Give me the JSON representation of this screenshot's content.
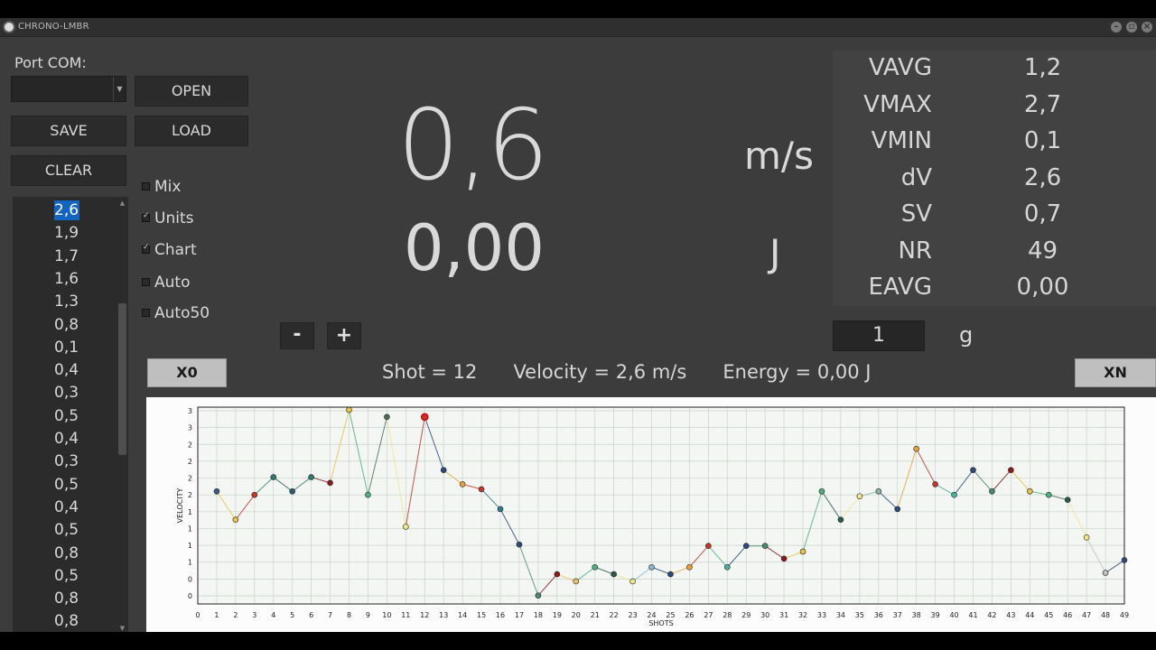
{
  "window": {
    "title": "CHRONO-LMBR"
  },
  "titlebar_buttons": {
    "minimize": "–",
    "restore": "▫",
    "close": "×"
  },
  "port": {
    "label": "Port COM:",
    "selected": ""
  },
  "buttons": {
    "open": "OPEN",
    "save": "SAVE",
    "load": "LOAD",
    "clear": "CLEAR",
    "minus": "-",
    "plus": "+",
    "x0": "X0",
    "xn": "XN"
  },
  "shot_list": [
    "2,6",
    "1,9",
    "1,7",
    "1,6",
    "1,3",
    "0,8",
    "0,1",
    "0,4",
    "0,3",
    "0,5",
    "0,4",
    "0,3",
    "0,5",
    "0,4",
    "0,5",
    "0,8",
    "0,5",
    "0,8",
    "0,8"
  ],
  "shot_list_selected_index": 0,
  "options": [
    {
      "label": "Mix",
      "checked": false
    },
    {
      "label": "Units",
      "checked": true
    },
    {
      "label": "Chart",
      "checked": true
    },
    {
      "label": "Auto",
      "checked": false
    },
    {
      "label": "Auto50",
      "checked": false
    }
  ],
  "display": {
    "velocity": "0,6",
    "velocity_unit": "m/s",
    "energy": "0,00",
    "energy_unit": "J"
  },
  "stats": [
    {
      "name": "VAVG",
      "value": "1,2"
    },
    {
      "name": "VMAX",
      "value": "2,7"
    },
    {
      "name": "VMIN",
      "value": "0,1"
    },
    {
      "name": "dV",
      "value": "2,6"
    },
    {
      "name": "SV",
      "value": "0,7"
    },
    {
      "name": "NR",
      "value": "49"
    },
    {
      "name": "EAVG",
      "value": "0,00"
    }
  ],
  "mass": {
    "value": "1",
    "unit": "g"
  },
  "shot_info": "Shot = 12      Velocity = 2,6 m/s      Energy = 0,00 J",
  "chart_data": {
    "type": "line",
    "xlabel": "SHOTS",
    "ylabel": "VELOCITY",
    "x_ticks": [
      "0",
      "1",
      "2",
      "3",
      "4",
      "5",
      "6",
      "7",
      "8",
      "9",
      "10",
      "11",
      "12",
      "13",
      "14",
      "15",
      "16",
      "17",
      "18",
      "19",
      "20",
      "21",
      "22",
      "23",
      "24",
      "25",
      "26",
      "27",
      "28",
      "29",
      "30",
      "31",
      "32",
      "33",
      "34",
      "35",
      "36",
      "37",
      "38",
      "39",
      "40",
      "41",
      "42",
      "43",
      "44",
      "45",
      "46",
      "47",
      "48",
      "49"
    ],
    "y_ticks": [
      "0",
      "0",
      "1",
      "1",
      "1",
      "1",
      "2",
      "2",
      "2",
      "2",
      "3",
      "3"
    ],
    "xlim": [
      0,
      49
    ],
    "ylim": [
      0,
      2.65
    ],
    "grid": true,
    "points": [
      {
        "x": 1,
        "y": 1.5,
        "color": "#3d5a8a"
      },
      {
        "x": 2,
        "y": 1.1,
        "color": "#e8c24a"
      },
      {
        "x": 3,
        "y": 1.45,
        "color": "#c0392b"
      },
      {
        "x": 4,
        "y": 1.7,
        "color": "#2e7d6e"
      },
      {
        "x": 5,
        "y": 1.5,
        "color": "#2e5a6e"
      },
      {
        "x": 6,
        "y": 1.7,
        "color": "#2e7d6e"
      },
      {
        "x": 7,
        "y": 1.62,
        "color": "#8b1a1a"
      },
      {
        "x": 8,
        "y": 2.65,
        "color": "#e8c24a"
      },
      {
        "x": 9,
        "y": 1.45,
        "color": "#4caf7d"
      },
      {
        "x": 10,
        "y": 2.55,
        "color": "#4a6e5a"
      },
      {
        "x": 11,
        "y": 1.0,
        "color": "#f0e68c"
      },
      {
        "x": 12,
        "y": 2.55,
        "color": "#c0392b"
      },
      {
        "x": 13,
        "y": 1.8,
        "color": "#2e4a7a"
      },
      {
        "x": 14,
        "y": 1.6,
        "color": "#e8a23a"
      },
      {
        "x": 15,
        "y": 1.53,
        "color": "#c0392b"
      },
      {
        "x": 16,
        "y": 1.25,
        "color": "#2e7d8e"
      },
      {
        "x": 17,
        "y": 0.75,
        "color": "#2e4a7a"
      },
      {
        "x": 18,
        "y": 0.03,
        "color": "#4a8a6e"
      },
      {
        "x": 19,
        "y": 0.33,
        "color": "#8b1a1a"
      },
      {
        "x": 20,
        "y": 0.23,
        "color": "#f0c060"
      },
      {
        "x": 21,
        "y": 0.43,
        "color": "#4caf7d"
      },
      {
        "x": 22,
        "y": 0.33,
        "color": "#2e5a4a"
      },
      {
        "x": 23,
        "y": 0.23,
        "color": "#f0e68c"
      },
      {
        "x": 24,
        "y": 0.43,
        "color": "#8ab8d0"
      },
      {
        "x": 25,
        "y": 0.33,
        "color": "#2e4a7a"
      },
      {
        "x": 26,
        "y": 0.43,
        "color": "#e8a23a"
      },
      {
        "x": 27,
        "y": 0.73,
        "color": "#c0392b"
      },
      {
        "x": 28,
        "y": 0.43,
        "color": "#4caf9d"
      },
      {
        "x": 29,
        "y": 0.73,
        "color": "#2e4a7a"
      },
      {
        "x": 30,
        "y": 0.73,
        "color": "#4a8a6e"
      },
      {
        "x": 31,
        "y": 0.55,
        "color": "#8b1a1a"
      },
      {
        "x": 32,
        "y": 0.65,
        "color": "#e8c24a"
      },
      {
        "x": 33,
        "y": 1.5,
        "color": "#4caf7d"
      },
      {
        "x": 34,
        "y": 1.1,
        "color": "#2e5a4a"
      },
      {
        "x": 35,
        "y": 1.43,
        "color": "#f0e68c"
      },
      {
        "x": 36,
        "y": 1.5,
        "color": "#8ab8a0"
      },
      {
        "x": 37,
        "y": 1.25,
        "color": "#2e4a7a"
      },
      {
        "x": 38,
        "y": 2.1,
        "color": "#e8a23a"
      },
      {
        "x": 39,
        "y": 1.6,
        "color": "#c0392b"
      },
      {
        "x": 40,
        "y": 1.45,
        "color": "#4caf9d"
      },
      {
        "x": 41,
        "y": 1.8,
        "color": "#2e4a7a"
      },
      {
        "x": 42,
        "y": 1.5,
        "color": "#4a8a6e"
      },
      {
        "x": 43,
        "y": 1.8,
        "color": "#8b1a1a"
      },
      {
        "x": 44,
        "y": 1.5,
        "color": "#e8c24a"
      },
      {
        "x": 45,
        "y": 1.45,
        "color": "#4caf7d"
      },
      {
        "x": 46,
        "y": 1.38,
        "color": "#2e5a4a"
      },
      {
        "x": 47,
        "y": 0.85,
        "color": "#f0e68c"
      },
      {
        "x": 48,
        "y": 0.35,
        "color": "#c0c0c0"
      },
      {
        "x": 49,
        "y": 0.53,
        "color": "#2e4a7a"
      }
    ],
    "highlight_x": 12
  }
}
